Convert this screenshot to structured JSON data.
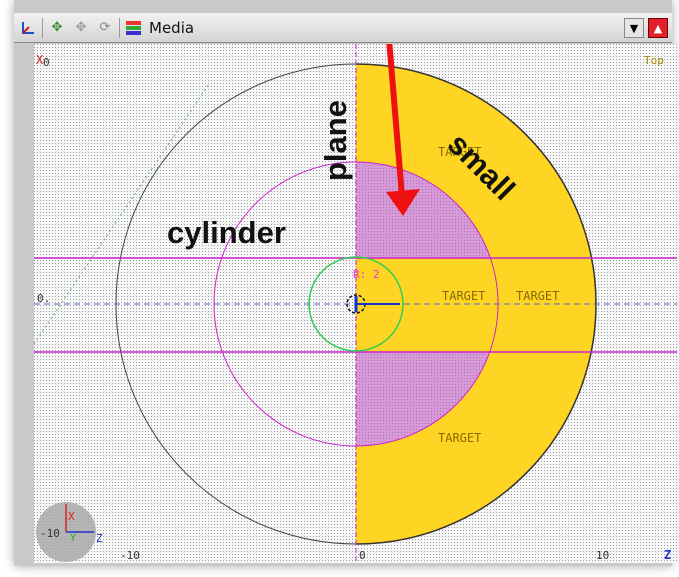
{
  "toolbar": {
    "media_label": "Media"
  },
  "viewport": {
    "view_name": "Top",
    "corner_axis_label": "X",
    "corner_axis_value": "0",
    "row_axis_value": "0.",
    "radius_label": "R: 2",
    "target_labels": [
      "TARGET",
      "TARGET",
      "TARGET",
      "TARGET"
    ],
    "x_ticks": [
      "-10",
      "0",
      "10"
    ],
    "z_axis_label": "Z",
    "gizmo": {
      "x": "X",
      "y": "Y",
      "z": "Z",
      "side_value": "-10"
    }
  },
  "annotations": {
    "plane": "plane",
    "cylinder": "cylinder",
    "small": "small"
  },
  "colors": {
    "target_fill": "#fed523",
    "small_region": "#d79ad8",
    "magenta_lines": "#cc22cc",
    "arrow": "#ee1111",
    "axis_blue": "#2244cc"
  }
}
